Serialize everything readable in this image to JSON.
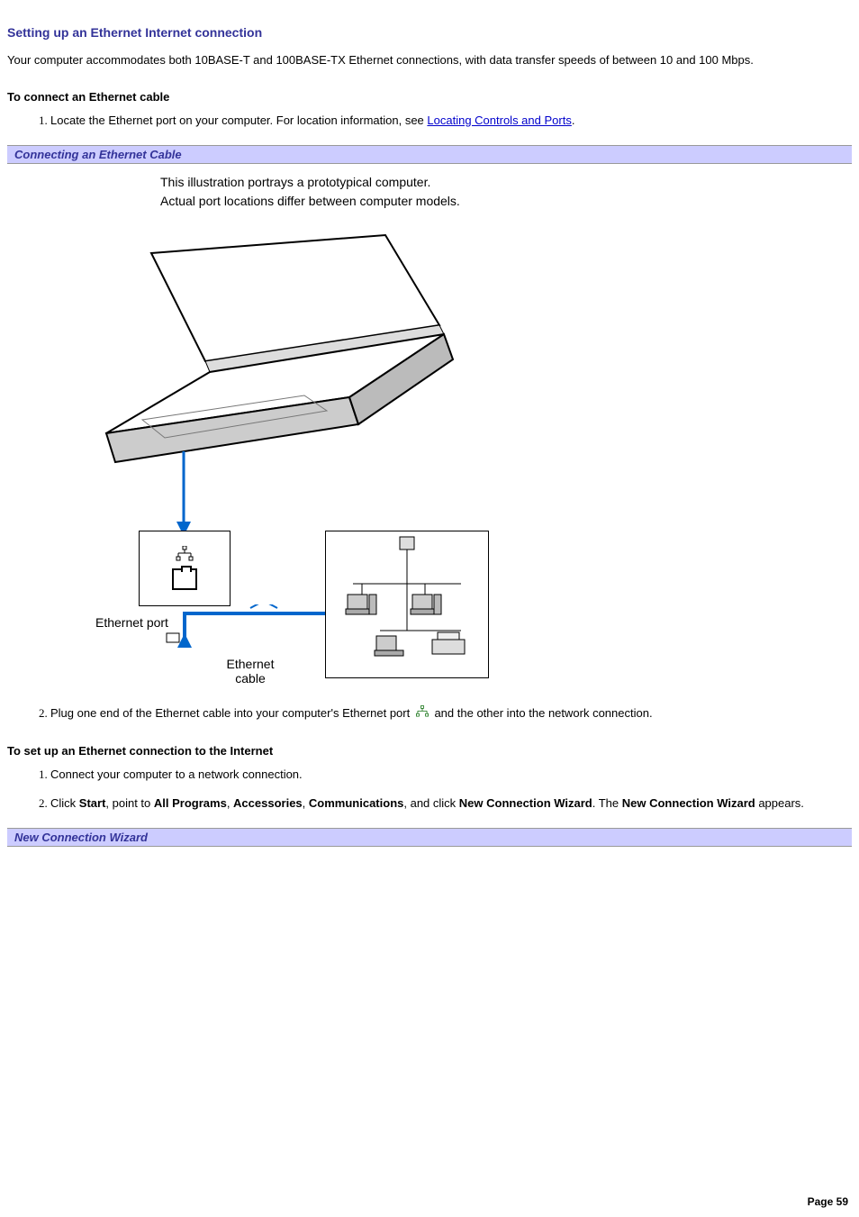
{
  "title": "Setting up an Ethernet Internet connection",
  "intro": "Your computer accommodates both 10BASE-T and 100BASE-TX Ethernet connections, with data transfer speeds of between 10 and 100 Mbps.",
  "section1": {
    "heading": "To connect an Ethernet cable",
    "step1_a": "Locate the Ethernet port on your computer. For location information, see ",
    "step1_link": "Locating Controls and Ports",
    "step1_b": ".",
    "figure_title": "Connecting an Ethernet Cable",
    "note_line1": "This illustration portrays a prototypical computer.",
    "note_line2": "Actual port locations differ between computer models.",
    "port_label": "Ethernet port",
    "cable_label_1": "Ethernet",
    "cable_label_2": "cable",
    "step2_a": "Plug one end of the Ethernet cable into your computer's Ethernet port ",
    "step2_b": " and the other into the network connection."
  },
  "section2": {
    "heading": "To set up an Ethernet connection to the Internet",
    "step1": "Connect your computer to a network connection.",
    "step2_a": "Click ",
    "step2_b1": "Start",
    "step2_c": ", point to ",
    "step2_b2": "All Programs",
    "step2_d": ", ",
    "step2_b3": "Accessories",
    "step2_e": ", ",
    "step2_b4": "Communications",
    "step2_f": ", and click ",
    "step2_b5": "New Connection Wizard",
    "step2_g": ". The ",
    "step2_b6": "New Connection Wizard",
    "step2_h": " appears.",
    "figure_title": "New Connection Wizard"
  },
  "footer": "Page 59"
}
